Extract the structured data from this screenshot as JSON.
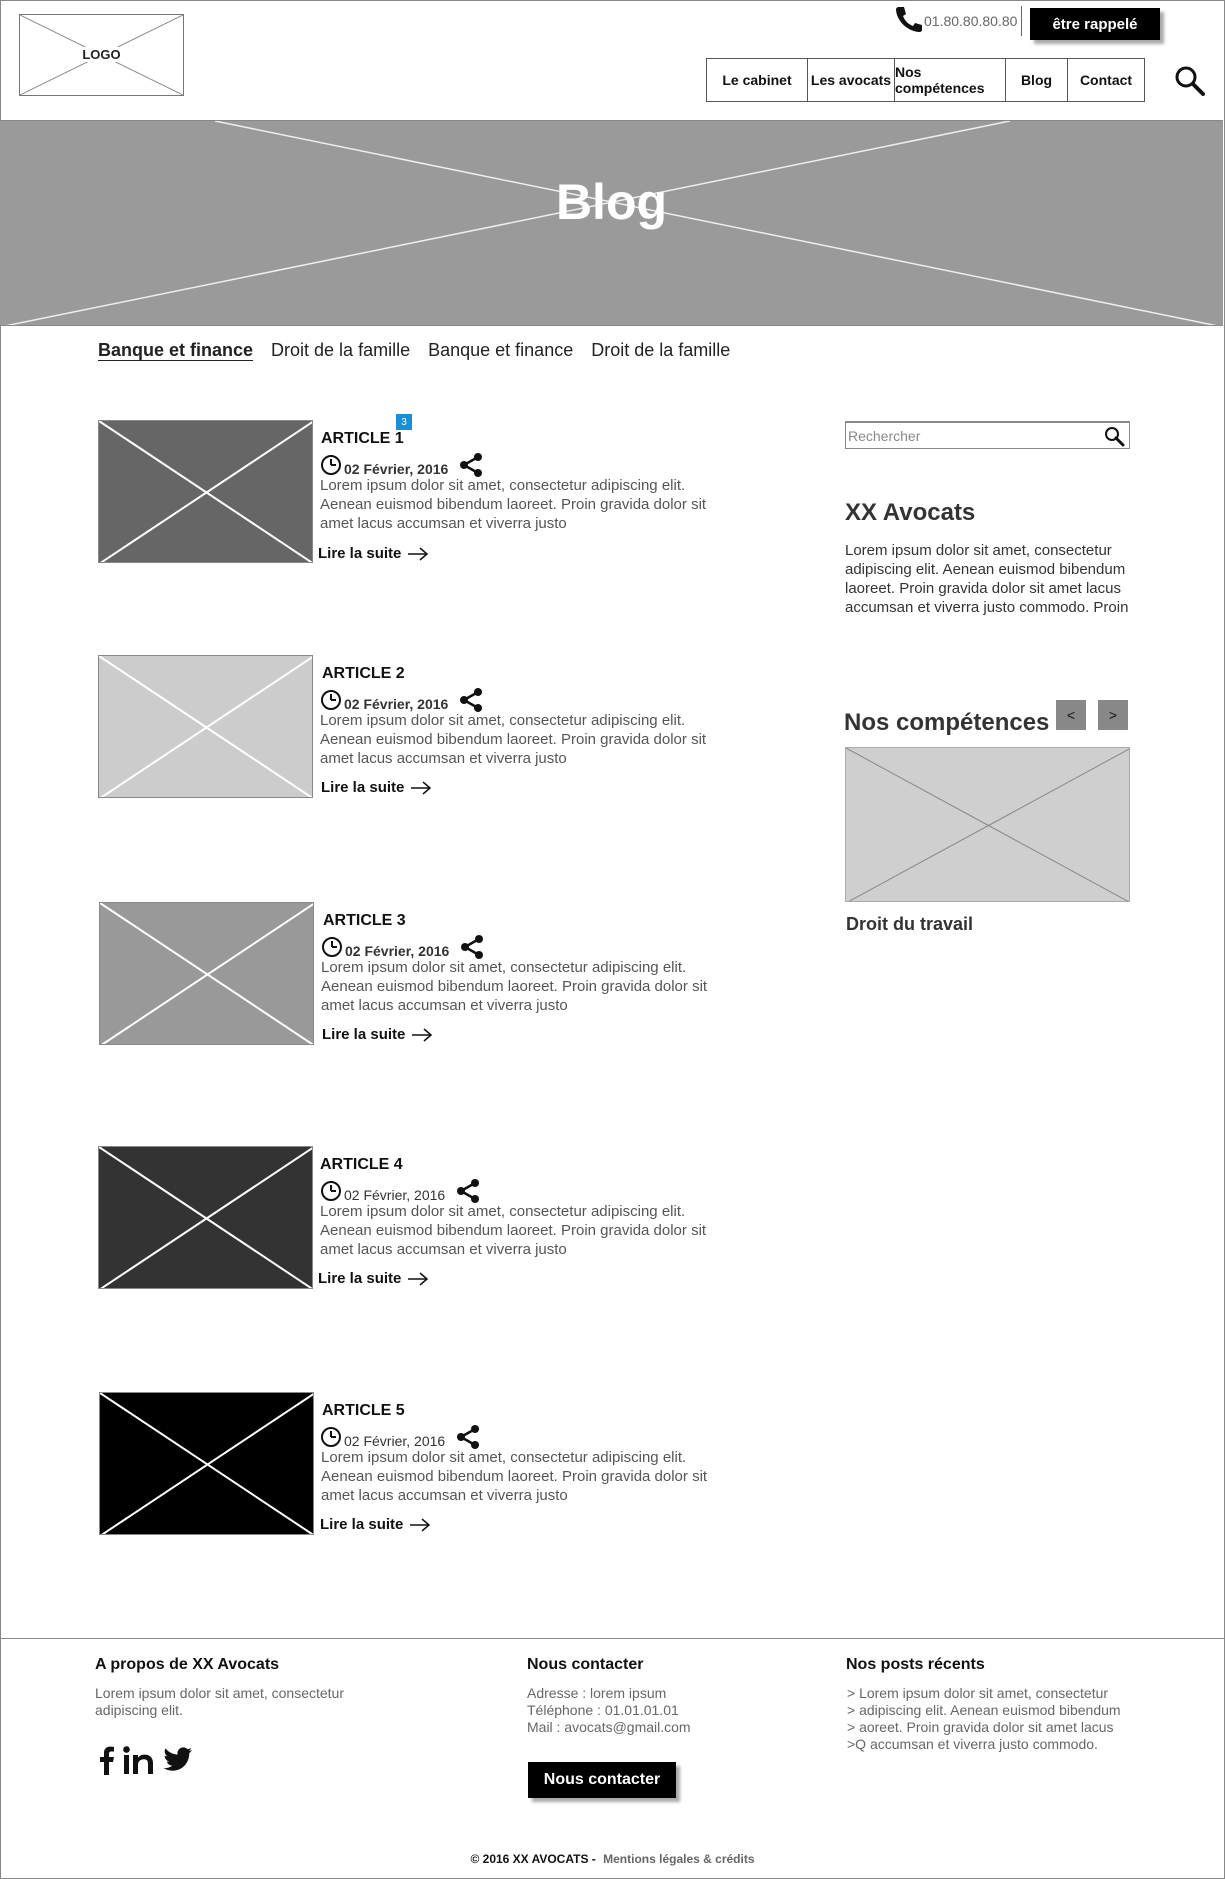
{
  "header": {
    "logo_text": "LOGO",
    "phone": "01.80.80.80.80",
    "callback_label": "être rappelé",
    "nav": [
      {
        "label": "Le cabinet"
      },
      {
        "label": "Les avocats"
      },
      {
        "label": "Nos compétences"
      },
      {
        "label": "Blog"
      },
      {
        "label": "Contact"
      }
    ]
  },
  "banner": {
    "title": "Blog"
  },
  "tabs": [
    {
      "label": "Banque et finance",
      "active": true
    },
    {
      "label": "Droit de la famille"
    },
    {
      "label": "Banque et finance"
    },
    {
      "label": "Droit de la famille"
    }
  ],
  "articles": [
    {
      "title": "ARTICLE 1",
      "badge": "3",
      "date": "02 Février, 2016",
      "excerpt": "Lorem ipsum dolor sit amet, consectetur adipiscing elit. Aenean euismod bibendum laoreet. Proin gravida dolor sit amet lacus accumsan et viverra justo",
      "more": "Lire la suite",
      "thumb_color": "#666666"
    },
    {
      "title": "ARTICLE 2",
      "date": "02 Février, 2016",
      "excerpt": "Lorem ipsum dolor sit amet, consectetur adipiscing elit. Aenean euismod bibendum laoreet. Proin gravida dolor sit amet lacus accumsan et viverra justo",
      "more": "Lire la suite",
      "thumb_color": "#cccccc"
    },
    {
      "title": "ARTICLE 3",
      "date": "02 Février, 2016",
      "excerpt": "Lorem ipsum dolor sit amet, consectetur adipiscing elit. Aenean euismod bibendum laoreet. Proin gravida dolor sit amet lacus accumsan et viverra justo",
      "more": "Lire la suite",
      "thumb_color": "#999999"
    },
    {
      "title": "ARTICLE 4",
      "date": "02 Février, 2016",
      "excerpt": "Lorem ipsum dolor sit amet, consectetur adipiscing elit. Aenean euismod bibendum laoreet. Proin gravida dolor sit amet lacus accumsan et viverra justo",
      "more": "Lire la suite",
      "thumb_color": "#333333"
    },
    {
      "title": "ARTICLE 5",
      "date": "02 Février, 2016",
      "excerpt": "Lorem ipsum dolor sit amet, consectetur adipiscing elit. Aenean euismod bibendum laoreet. Proin gravida dolor sit amet lacus accumsan et viverra justo",
      "more": "Lire la suite",
      "thumb_color": "#000000"
    }
  ],
  "sidebar": {
    "search_placeholder": "Rechercher",
    "about_title": "XX Avocats",
    "about_text": "Lorem ipsum dolor sit amet, consectetur adipiscing elit. Aenean euismod bibendum laoreet. Proin gravida dolor sit amet lacus accumsan et viverra justo commodo. Proin",
    "competences_title": "Nos compétences",
    "prev_label": "<",
    "next_label": ">",
    "competence_label": "Droit du travail"
  },
  "footer": {
    "about_title": "A propos de XX Avocats",
    "about_text": "Lorem ipsum dolor sit amet, consectetur adipiscing elit.",
    "contact_title": "Nous contacter",
    "address": "Adresse : lorem ipsum",
    "phone": "Téléphone : 01.01.01.01",
    "mail": "Mail : avocats@gmail.com",
    "contact_button": "Nous contacter",
    "posts_title": "Nos posts récents",
    "posts": [
      "> Lorem ipsum dolor sit amet, consectetur",
      "> adipiscing elit. Aenean euismod bibendum",
      "> aoreet. Proin gravida dolor sit amet lacus",
      ">Q accumsan et viverra justo commodo."
    ],
    "copyright": "© 2016 XX AVOCATS -",
    "legal": "Mentions légales & crédits"
  }
}
